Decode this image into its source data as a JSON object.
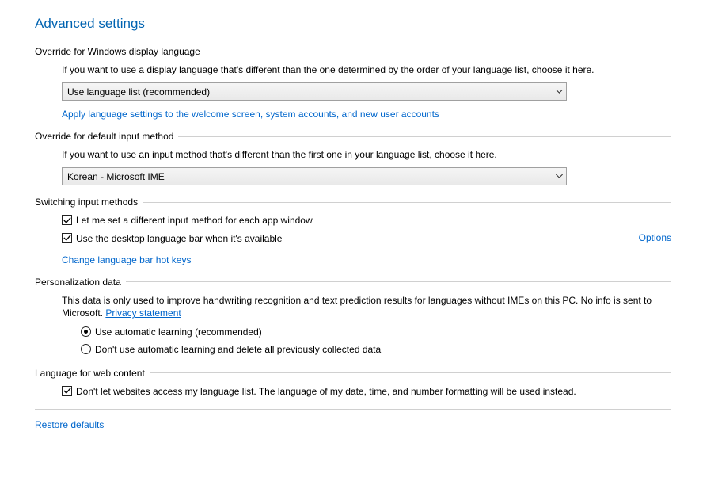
{
  "title": "Advanced settings",
  "override_display": {
    "heading": "Override for Windows display language",
    "desc": "If you want to use a display language that's different than the one determined by the order of your language list, choose it here.",
    "selected": "Use language list (recommended)",
    "apply_link": "Apply language settings to the welcome screen, system accounts, and new user accounts"
  },
  "override_input": {
    "heading": "Override for default input method",
    "desc": "If you want to use an input method that's different than the first one in your language list, choose it here.",
    "selected": "Korean - Microsoft IME"
  },
  "switching": {
    "heading": "Switching input methods",
    "check1": "Let me set a different input method for each app window",
    "check2": "Use the desktop language bar when it's available",
    "options": "Options",
    "hotkeys": "Change language bar hot keys"
  },
  "personalization": {
    "heading": "Personalization data",
    "desc_part1": "This data is only used to improve handwriting recognition and text prediction results for languages without IMEs on this PC. No info is sent to Microsoft. ",
    "privacy": "Privacy statement",
    "radio1": "Use automatic learning (recommended)",
    "radio2": "Don't use automatic learning and delete all previously collected data"
  },
  "web_content": {
    "heading": "Language for web content",
    "check": "Don't let websites access my language list. The language of my date, time, and number formatting will be used instead."
  },
  "restore": "Restore defaults"
}
